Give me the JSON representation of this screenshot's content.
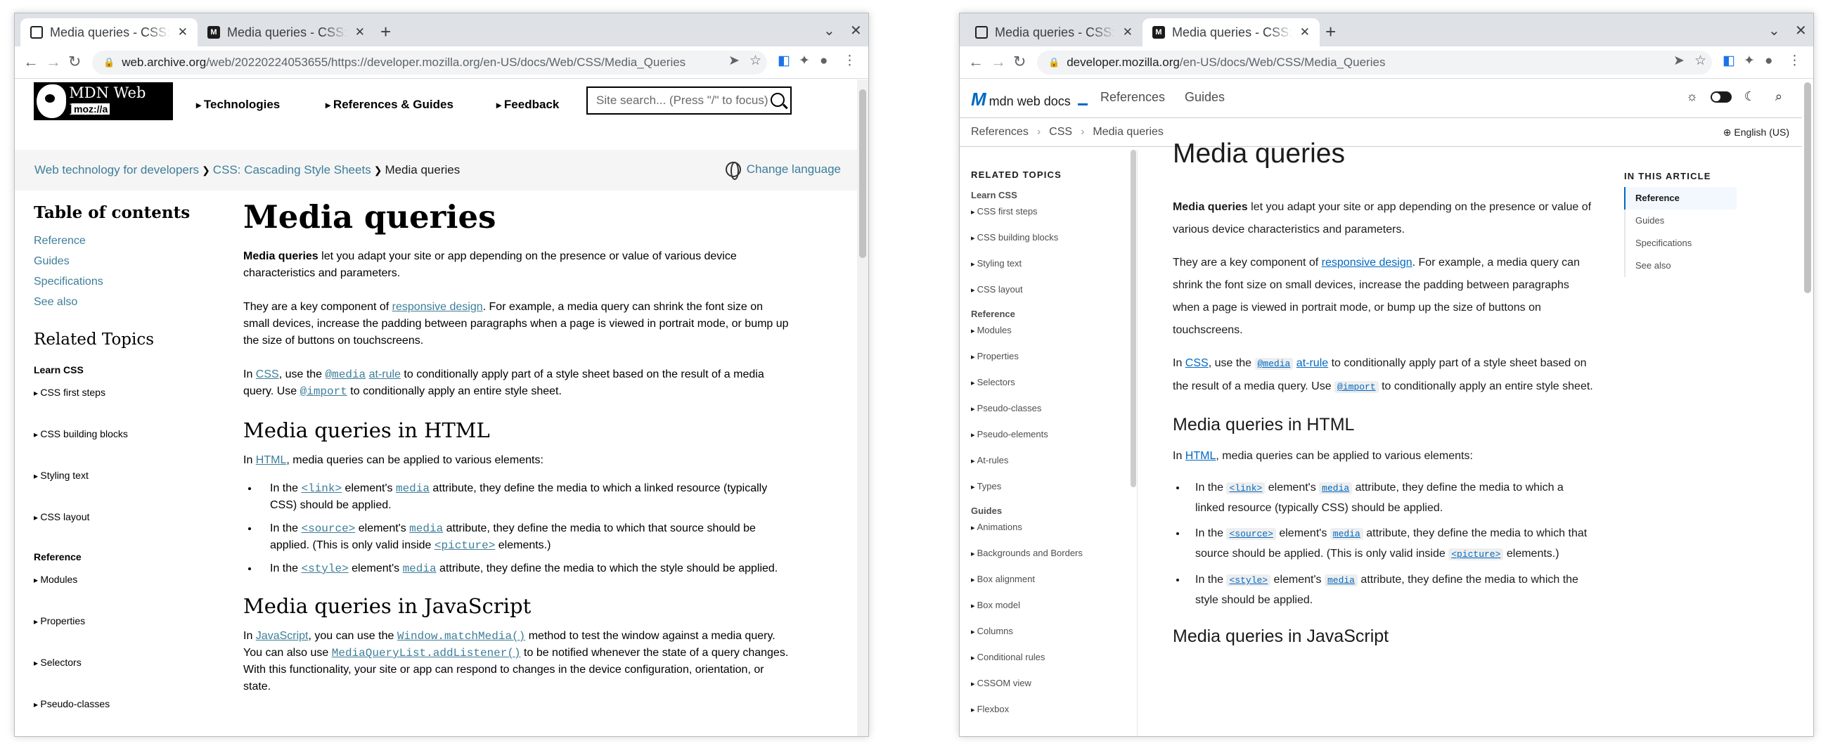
{
  "left_window": {
    "tabs": [
      {
        "title": "Media queries - CSS: Ca",
        "active": true
      },
      {
        "title": "Media queries - CSS: Ca",
        "active": false
      }
    ],
    "url_host": "web.archive.org",
    "url_path": "/web/20220224053655/https://developer.mozilla.org/en-US/docs/Web/CSS/Media_Queries",
    "header": {
      "logo_line1": "MDN Web Docs",
      "logo_line2": "moz://a",
      "nav": [
        "Technologies",
        "References & Guides",
        "Feedback"
      ],
      "search_placeholder": "Site search... (Press \"/\" to focus)"
    },
    "breadcrumb": {
      "items": [
        "Web technology for developers",
        "CSS: Cascading Style Sheets",
        "Media queries"
      ],
      "language": "Change language"
    },
    "toc": {
      "heading": "Table of contents",
      "items": [
        "Reference",
        "Guides",
        "Specifications",
        "See also"
      ]
    },
    "related": {
      "heading": "Related Topics",
      "group1": "Learn CSS",
      "group1_items": [
        "CSS first steps",
        "CSS building blocks",
        "Styling text",
        "CSS layout"
      ],
      "group2": "Reference",
      "group2_items": [
        "Modules",
        "Properties",
        "Selectors",
        "Pseudo-classes"
      ]
    },
    "article": {
      "h1": "Media queries",
      "p1_strong": "Media queries",
      "p1_rest": " let you adapt your site or app depending on the presence or value of various device characteristics and parameters.",
      "p2_a": "They are a key component of ",
      "p2_link": "responsive design",
      "p2_b": ". For example, a media query can shrink the font size on small devices, increase the padding between paragraphs when a page is viewed in portrait mode, or bump up the size of buttons on touchscreens.",
      "p3_a": "In ",
      "p3_link_css": "CSS",
      "p3_b": ", use the ",
      "p3_code_media": "@media",
      "p3_link_atrule": "at-rule",
      "p3_c": " to conditionally apply part of a style sheet based on the result of a media query. Use ",
      "p3_code_import": "@import",
      "p3_d": " to conditionally apply an entire style sheet.",
      "h2_html": "Media queries in HTML",
      "p4_a": "In ",
      "p4_link": "HTML",
      "p4_b": ", media queries can be applied to various elements:",
      "li1_a": "In the ",
      "li1_code": "<link>",
      "li1_b": " element's ",
      "li1_attr": "media",
      "li1_c": " attribute, they define the media to which a linked resource (typically CSS) should be applied.",
      "li2_a": "In the ",
      "li2_code": "<source>",
      "li2_b": " element's ",
      "li2_attr": "media",
      "li2_c": " attribute, they define the media to which that source should be applied. (This is only valid inside ",
      "li2_code2": "<picture>",
      "li2_d": " elements.)",
      "li3_a": "In the ",
      "li3_code": "<style>",
      "li3_b": " element's ",
      "li3_attr": "media",
      "li3_c": " attribute, they define the media to which the style should be applied.",
      "h2_js": "Media queries in JavaScript",
      "p5_a": "In ",
      "p5_link": "JavaScript",
      "p5_b": ", you can use the ",
      "p5_code1": "Window.matchMedia()",
      "p5_c": " method to test the window against a media query. You can also use ",
      "p5_code2": "MediaQueryList.addListener()",
      "p5_d": " to be notified whenever the state of a query changes. With this functionality, your site or app can respond to changes in the device configuration, orientation, or state."
    }
  },
  "right_window": {
    "tabs": [
      {
        "title": "Media queries - CSS: Ca",
        "active": false
      },
      {
        "title": "Media queries - CSS: Ca",
        "active": true
      }
    ],
    "url_host": "developer.mozilla.org",
    "url_path": "/en-US/docs/Web/CSS/Media_Queries",
    "header": {
      "logo_mark": "M",
      "logo_text": "mdn web docs",
      "nav": [
        "References",
        "Guides"
      ]
    },
    "breadcrumb": {
      "items": [
        "References",
        "CSS",
        "Media queries"
      ],
      "language": "English (US)"
    },
    "sidebar": {
      "heading": "RELATED TOPICS",
      "group1": "Learn CSS",
      "group1_items": [
        "CSS first steps",
        "CSS building blocks",
        "Styling text",
        "CSS layout"
      ],
      "group2": "Reference",
      "group2_items": [
        "Modules",
        "Properties",
        "Selectors",
        "Pseudo-classes",
        "Pseudo-elements",
        "At-rules",
        "Types"
      ],
      "group3": "Guides",
      "group3_items": [
        "Animations",
        "Backgrounds and Borders",
        "Box alignment",
        "Box model",
        "Columns",
        "Conditional rules",
        "CSSOM view",
        "Flexbox"
      ]
    },
    "toc": {
      "heading": "IN THIS ARTICLE",
      "items": [
        "Reference",
        "Guides",
        "Specifications",
        "See also"
      ]
    },
    "article": {
      "h1": "Media queries",
      "h2_html": "Media queries in HTML",
      "h2_js": "Media queries in JavaScript"
    }
  }
}
